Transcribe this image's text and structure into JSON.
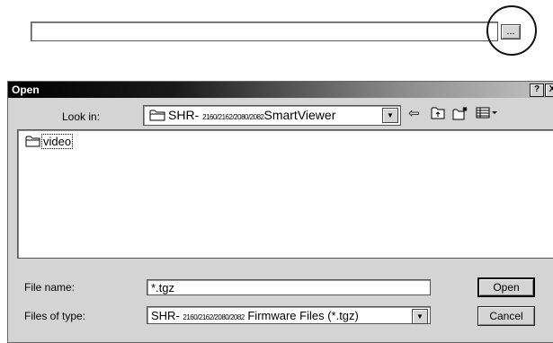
{
  "browse": {
    "path_value": "",
    "button_label": "..."
  },
  "dialog": {
    "title": "Open",
    "help_button": "?",
    "close_button": "X",
    "look_in_label": "Look in:",
    "look_in_prefix": "SHR- ",
    "look_in_models": "2160/2162/2080/2082",
    "look_in_suffix": "SmartViewer",
    "toolbar_icons": [
      "back-icon",
      "up-folder-icon",
      "new-folder-icon",
      "view-menu-icon"
    ],
    "files": [
      {
        "name": "video",
        "icon": "folder-icon"
      }
    ],
    "file_name_label": "File name:",
    "file_name_value": "*.tgz",
    "file_type_label": "Files of type:",
    "file_type_prefix": "SHR- ",
    "file_type_models": "2160/2162/2080/2082",
    "file_type_suffix": " Firmware Files (*.tgz)",
    "open_button": "Open",
    "cancel_button": "Cancel"
  }
}
